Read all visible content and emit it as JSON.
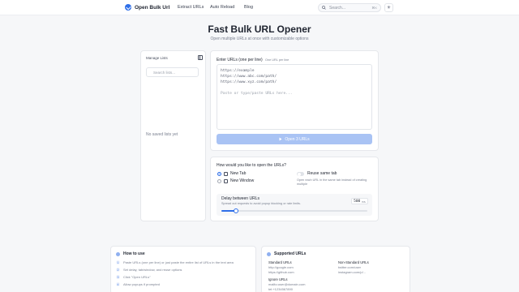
{
  "header": {
    "brand": "Open Bulk Url",
    "nav": [
      {
        "label": "Extract URLs"
      },
      {
        "label": "Auto Reload"
      },
      {
        "label": "Blog"
      }
    ],
    "search_label": "Search...",
    "search_shortcut": "⌘K",
    "theme_icon": "☀"
  },
  "hero": {
    "title": "Fast Bulk URL Opener",
    "subtitle": "Open multiple URLs at once with customizable options"
  },
  "sidebar": {
    "title": "Manage Lists",
    "search_placeholder": "Search lists...",
    "empty_text": "No saved lists yet"
  },
  "editor": {
    "label": "Enter URLs (one per line)",
    "hint": "One URL per line",
    "lines": [
      "https://example",
      "https://www.abc.com/path/",
      "https://www.xyz.com/path/"
    ],
    "placeholder": "Paste or type/paste URLs here...",
    "open_button": "Open 3 URLs"
  },
  "options": {
    "question": "How would you like to open the URLs?",
    "mode_new_tab": "New Tab",
    "mode_new_window": "New Window",
    "selected_mode": "New Tab",
    "reuse_label": "Reuse same tab",
    "reuse_desc": "Open each URL in the same tab instead of creating multiple",
    "reuse_enabled": false,
    "delay_label": "Delay between URLs",
    "delay_desc": "Spread out requests to avoid popup blocking or rate limits.",
    "delay_value": "500",
    "delay_unit": "ms",
    "delay_fraction": 0.1
  },
  "how_to": {
    "title": "How to use",
    "steps": [
      {
        "num": "1",
        "text": "Paste URLs (one per line) or just paste the entire list of URLs in the text area"
      },
      {
        "num": "2",
        "text": "Set delay, tab/window, and reuse options"
      },
      {
        "num": "3",
        "text": "Click \"Open URLs\""
      },
      {
        "num": "4",
        "text": "Allow popups if prompted"
      }
    ]
  },
  "supported": {
    "title": "Supported URLs",
    "standard_title": "Standard URLs",
    "standard": [
      "http://google.com",
      "https://github.com"
    ],
    "nonstandard_title": "Non-Standard URLs",
    "nonstandard": [
      "twitter.com/user",
      "instagram.com/p/..."
    ],
    "ignore_title": "Ignore URLs",
    "ignore": [
      "mailto:user@domain.com",
      "tel:+1234567890"
    ]
  },
  "colors": {
    "accent": "#2f6fe8",
    "button_disabled": "#a9c3f4"
  }
}
